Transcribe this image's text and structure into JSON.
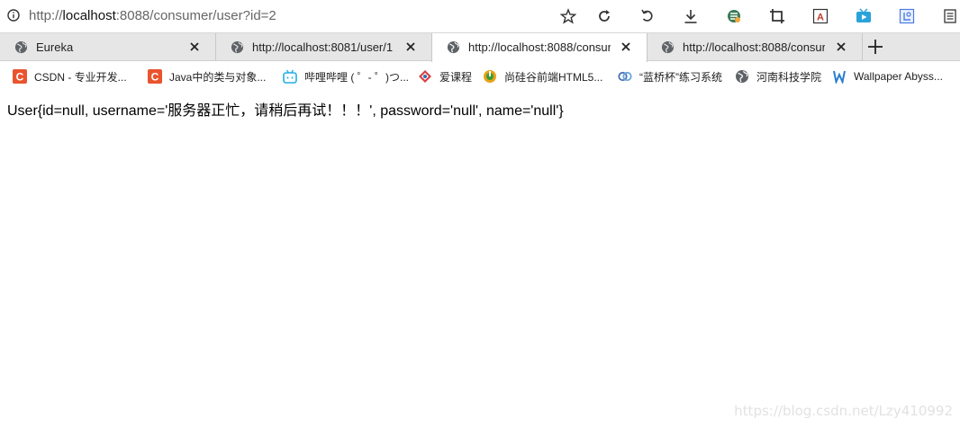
{
  "address_bar": {
    "url_prefix": "http://",
    "url_host": "localhost",
    "url_rest": ":8088/consumer/user?id=2"
  },
  "toolbar_icons": [
    "star-icon",
    "refresh-icon",
    "undo-icon",
    "download-icon",
    "extension-icon",
    "crop-icon",
    "translate-icon",
    "video-icon",
    "screenshot-icon",
    "reader-icon"
  ],
  "tabs": [
    {
      "title": "Eureka",
      "active": false
    },
    {
      "title": "http://localhost:8081/user/1",
      "active": false
    },
    {
      "title": "http://localhost:8088/consur",
      "active": true
    },
    {
      "title": "http://localhost:8088/consur",
      "active": false
    }
  ],
  "bookmarks": [
    {
      "label": "CSDN - 专业开发...",
      "icon": "csdn-icon",
      "color": "#e9542e"
    },
    {
      "label": "Java中的类与对象...",
      "icon": "csdn-icon",
      "color": "#e9542e"
    },
    {
      "label": "哔哩哔哩 ( ゜- ゜)つ...",
      "icon": "bilibili-icon",
      "color": "#23ade5"
    },
    {
      "label": "爱课程",
      "icon": "icourse-icon",
      "color": "#d64141"
    },
    {
      "label": "尚硅谷前端HTML5...",
      "icon": "atguigu-icon",
      "color": "#e8a316"
    },
    {
      "label": "“蓝桥杯”练习系统",
      "icon": "lanqiao-icon",
      "color": "#4a6fb5"
    },
    {
      "label": "河南科技学院",
      "icon": "globe-icon",
      "color": "#5f6368"
    },
    {
      "label": "Wallpaper Abyss...",
      "icon": "wallpaper-icon",
      "color": "#2a7dd1"
    }
  ],
  "page": {
    "body_text": "User{id=null, username='服务器正忙，请稍后再试！！！', password='null', name='null'}"
  },
  "watermark": "https://blog.csdn.net/Lzy410992"
}
